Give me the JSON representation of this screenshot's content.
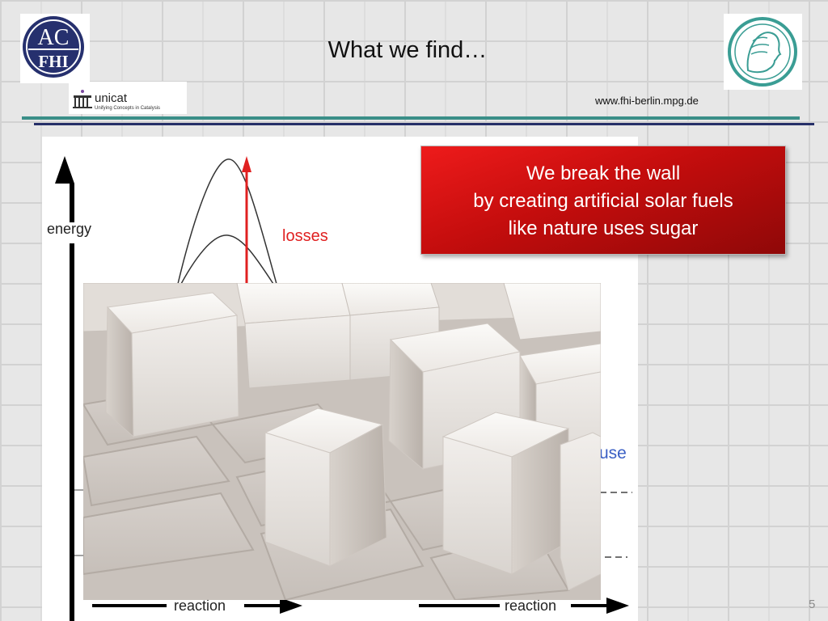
{
  "header": {
    "title": "What we find…",
    "url": "www.fhi-berlin.mpg.de",
    "logos": {
      "acfhi_top": "AC",
      "acfhi_bottom": "FHI",
      "unicat_name": "unicat",
      "unicat_tagline": "Unifying Concepts in Catalysis"
    }
  },
  "callout": {
    "line1": "We break the wall",
    "line2": "by creating artificial solar fuels",
    "line3": "like nature uses sugar"
  },
  "diagram": {
    "energy_label": "energy",
    "losses_label": "losses",
    "use_label": "use",
    "reaction_left": "reaction",
    "reaction_right": "reaction"
  },
  "footer": {
    "page_number": "5"
  },
  "colors": {
    "callout_red": "#d01010",
    "rule_teal": "#3a8f88",
    "rule_navy": "#262f68",
    "logo_navy": "#26306e",
    "logo_teal": "#3a9d94",
    "losses_red": "#e02121",
    "use_blue": "#3a5fc4"
  }
}
